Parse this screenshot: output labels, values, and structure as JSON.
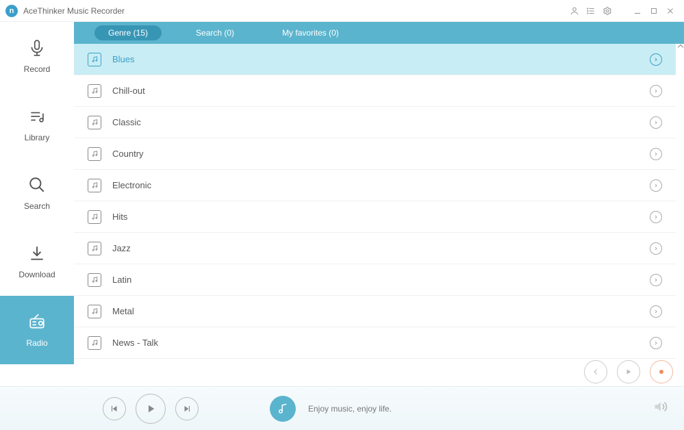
{
  "app": {
    "title": "AceThinker Music Recorder"
  },
  "sidebar": {
    "items": [
      {
        "label": "Record"
      },
      {
        "label": "Library"
      },
      {
        "label": "Search"
      },
      {
        "label": "Download"
      },
      {
        "label": "Radio"
      }
    ]
  },
  "tabs": [
    {
      "label": "Genre (15)",
      "active": true
    },
    {
      "label": "Search (0)",
      "active": false
    },
    {
      "label": "My favorites (0)",
      "active": false
    }
  ],
  "genres": [
    {
      "label": "Blues",
      "selected": true
    },
    {
      "label": "Chill-out",
      "selected": false
    },
    {
      "label": "Classic",
      "selected": false
    },
    {
      "label": "Country",
      "selected": false
    },
    {
      "label": "Electronic",
      "selected": false
    },
    {
      "label": "Hits",
      "selected": false
    },
    {
      "label": "Jazz",
      "selected": false
    },
    {
      "label": "Latin",
      "selected": false
    },
    {
      "label": "Metal",
      "selected": false
    },
    {
      "label": "News - Talk",
      "selected": false
    }
  ],
  "player": {
    "status": "Enjoy music, enjoy life."
  }
}
